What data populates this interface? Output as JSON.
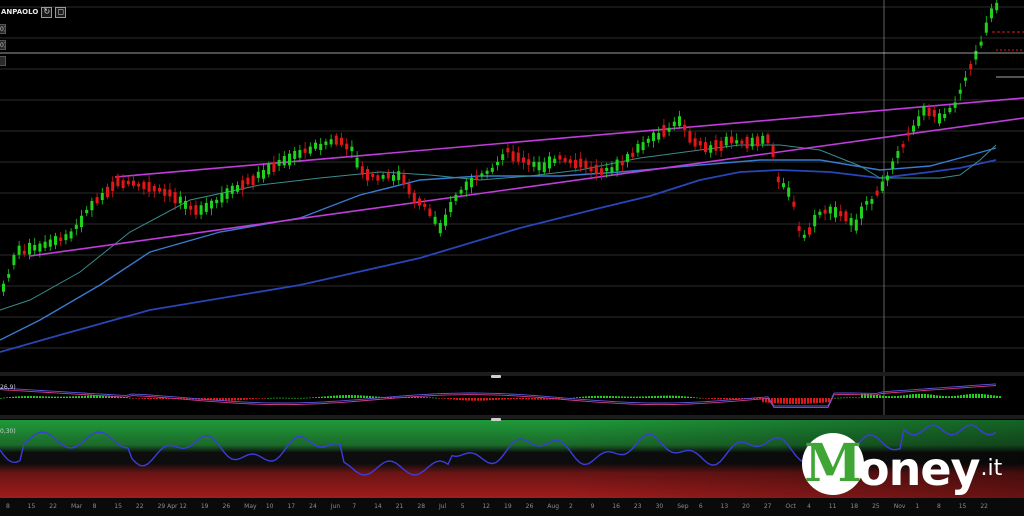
{
  "toolbar": {
    "symbol": "ANPAOLO",
    "refresh_icon": "refresh-icon",
    "expand_icon": "expand-icon"
  },
  "side_tabs": [
    {
      "label": "0)"
    },
    {
      "label": "0)"
    },
    {
      "label": ""
    }
  ],
  "macd": {
    "label": "26,9)"
  },
  "rsi": {
    "label": "0,30)"
  },
  "x_axis": {
    "ticks": [
      "8",
      "15",
      "22",
      "Mar",
      "8",
      "15",
      "22",
      "29 Apr",
      "12",
      "19",
      "26",
      "May",
      "10",
      "17",
      "24",
      "Jun",
      "7",
      "14",
      "21",
      "28",
      "Jul",
      "5",
      "12",
      "19",
      "26",
      "Aug",
      "2",
      "9",
      "16",
      "23",
      "30",
      "Sep",
      "6",
      "13",
      "20",
      "27",
      "Oct",
      "4",
      "11",
      "18",
      "25",
      "Nov",
      "1",
      "8",
      "15",
      "22"
    ]
  },
  "watermark": {
    "brand": "oney",
    "tld": ".it",
    "badge_letter": "M"
  },
  "colors": {
    "up": "#1ed21e",
    "down": "#e01818",
    "trendline": "#c03cdc",
    "ma_short": "#3a8c8c",
    "ma_mid": "#3a7ad0",
    "ma_long": "#2846b8",
    "macd_line": "#5a5ae0",
    "signal_line": "#d03c8c",
    "rsi_line": "#3c3cdc",
    "crosshair": "#8a8a8a"
  }
}
